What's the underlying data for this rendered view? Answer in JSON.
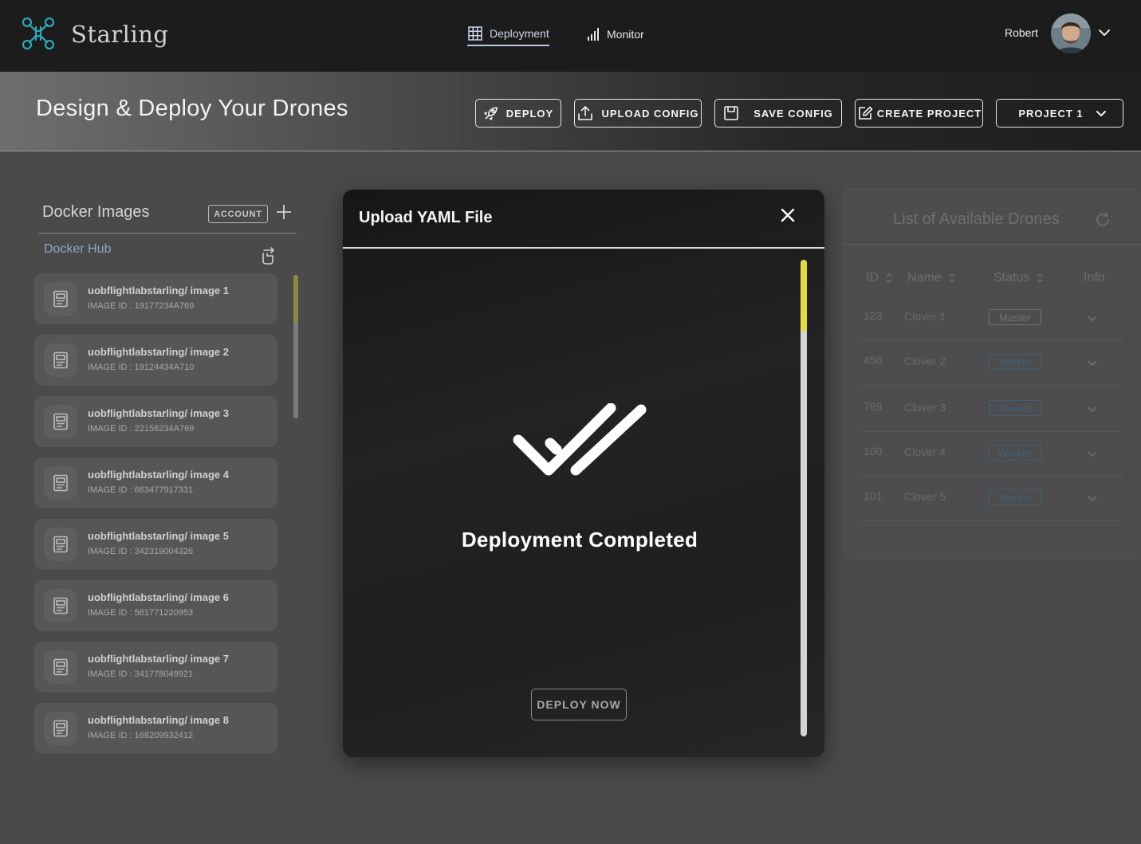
{
  "app": {
    "brand": "Starling",
    "user_name": "Robert"
  },
  "nav": {
    "tabs": [
      {
        "label": "Deployment",
        "icon": "grid-icon",
        "active": true
      },
      {
        "label": "Monitor",
        "icon": "signal-bars-icon",
        "active": false
      }
    ]
  },
  "header": {
    "title": "Design & Deploy Your Drones",
    "buttons": {
      "deploy": "DEPLOY",
      "upload_config": "UPLOAD CONFIG",
      "save_config": "SAVE CONFIG",
      "create_project": "CREATE PROJECT",
      "project_select": "PROJECT 1"
    }
  },
  "docker_panel": {
    "title": "Docker Images",
    "account_badge": "ACCOUNT",
    "hub_label": "Docker Hub",
    "images": [
      {
        "name": "uobflightlabstarling/ image 1",
        "id": "IMAGE ID : 19177234A769"
      },
      {
        "name": "uobflightlabstarling/ image 2",
        "id": "IMAGE ID : 19124434A710"
      },
      {
        "name": "uobflightlabstarling/ image 3",
        "id": "IMAGE ID : 22156234A769"
      },
      {
        "name": "uobflightlabstarling/ image 4",
        "id": "IMAGE ID : 663477917331"
      },
      {
        "name": "uobflightlabstarling/ image 5",
        "id": "IMAGE ID : 342319004326"
      },
      {
        "name": "uobflightlabstarling/ image 6",
        "id": "IMAGE ID : 561771220953"
      },
      {
        "name": "uobflightlabstarling/ image 7",
        "id": "IMAGE ID : 341778049921"
      },
      {
        "name": "uobflightlabstarling/ image 8",
        "id": "IMAGE ID : 168209932412"
      }
    ]
  },
  "drones_panel": {
    "title": "List of Available Drones",
    "columns": [
      "ID",
      "Name",
      "Status",
      "Info"
    ],
    "rows": [
      {
        "id": "123",
        "name": "Clover 1",
        "status": "Master"
      },
      {
        "id": "456",
        "name": "Clover 2",
        "status": "Worker"
      },
      {
        "id": "789",
        "name": "Clover 3",
        "status": "Worker"
      },
      {
        "id": "100",
        "name": "Clover 4",
        "status": "Worker"
      },
      {
        "id": "101",
        "name": "Clover 5",
        "status": "Worker"
      }
    ]
  },
  "modal": {
    "title": "Upload YAML File",
    "message": "Deployment Completed",
    "deploy_now": "DEPLOY NOW"
  },
  "colors": {
    "accent_teal": "#2aa9b8",
    "scroll_thumb_yellow": "#e3dc3c",
    "topbar_bg": "#1c1c1c",
    "page_bg": "#4a4a4a"
  }
}
